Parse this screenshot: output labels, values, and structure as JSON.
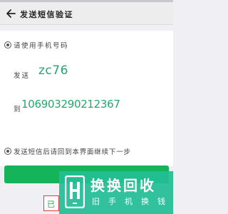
{
  "navbar": {
    "title": "发送短信验证",
    "back_icon": "back-arrow-icon"
  },
  "instructions": {
    "step1": "请使用手机号码",
    "send_label": "发送",
    "code": "zc76",
    "to_label": "到",
    "number": "106903290212367",
    "step2": "发送短信后请回到本界面继续下一步"
  },
  "buttons": {
    "secondary_label": "已"
  },
  "watermark": {
    "logo_icon": "brand-h-logo-icon",
    "text_main": "换换回收",
    "text_sub": "旧手机换钱"
  },
  "colors": {
    "accent_green": "#16b45a",
    "code_green": "#26a66e",
    "highlight_red": "#e23b3b",
    "watermark_teal": "#22be96"
  }
}
